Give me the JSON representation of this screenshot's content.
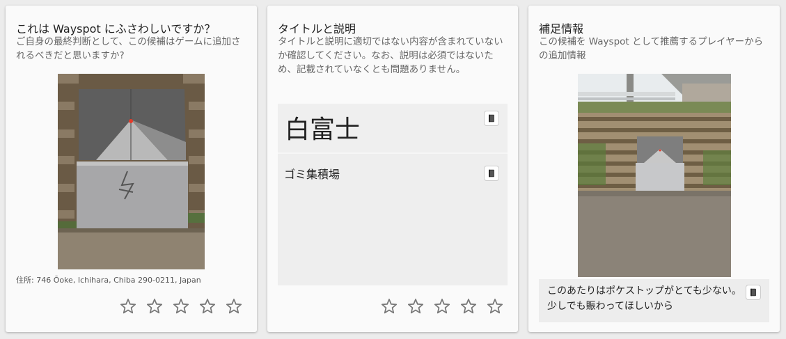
{
  "card1": {
    "title": "これは Wayspot にふさわしいですか？",
    "description": "ご自身の最終判断として、この候補はゲームに追加されるべきだと思いますか?",
    "address": "住所: 746 Ōoke, Ichihara, Chiba 290-0211, Japan"
  },
  "card2": {
    "title": "タイトルと説明",
    "description": "タイトルと説明に適切ではない内容が含まれていないか確認してください。なお、説明は必須ではないため、記載されていなくとも問題ありません。",
    "candidate_title": "白富士",
    "candidate_description": "ゴミ集積場"
  },
  "card3": {
    "title": "補足情報",
    "description": "この候補を Wayspot として推薦するプレイヤーからの追加情報",
    "supplemental_text": "このあたりはポケストップがとても少ない。少しでも賑わってほしいから"
  },
  "rating": {
    "max_stars": 5,
    "star_color": "#777777"
  },
  "icons": {
    "translate": "book-icon",
    "star": "star-outline-icon"
  }
}
